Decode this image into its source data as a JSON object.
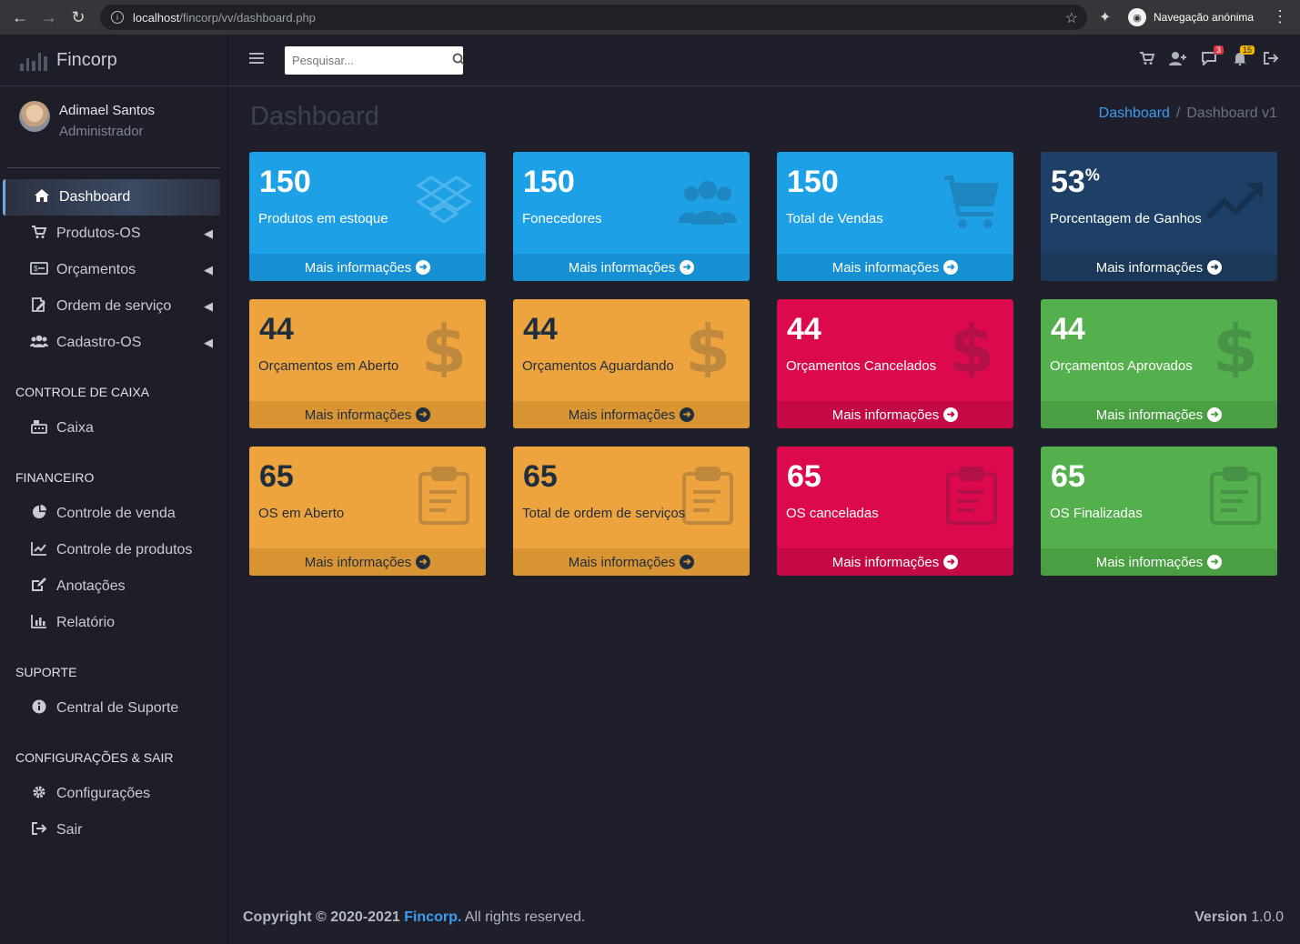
{
  "browser": {
    "url_host": "localhost",
    "url_path": "/fincorp/vv/dashboard.php",
    "incognito_label": "Navegação anónima"
  },
  "brand": {
    "name": "Fincorp"
  },
  "user": {
    "name": "Adimael Santos",
    "role": "Administrador"
  },
  "sidebar": {
    "main": [
      {
        "label": "Dashboard",
        "icon": "home-icon",
        "active": true
      },
      {
        "label": "Produtos-OS",
        "icon": "cart-icon"
      },
      {
        "label": "Orçamentos",
        "icon": "money-icon"
      },
      {
        "label": "Ordem de serviço",
        "icon": "edit-doc-icon"
      },
      {
        "label": "Cadastro-OS",
        "icon": "users-icon"
      }
    ],
    "sections": [
      {
        "title": "CONTROLE DE CAIXA",
        "items": [
          {
            "label": "Caixa",
            "icon": "cash-register-icon"
          }
        ]
      },
      {
        "title": "FINANCEIRO",
        "items": [
          {
            "label": "Controle de venda",
            "icon": "pie-chart-icon"
          },
          {
            "label": "Controle de produtos",
            "icon": "line-chart-icon"
          },
          {
            "label": "Anotações",
            "icon": "edit-icon"
          },
          {
            "label": "Relatório",
            "icon": "bar-chart-icon"
          }
        ]
      },
      {
        "title": "SUPORTE",
        "items": [
          {
            "label": "Central de Suporte",
            "icon": "info-icon"
          }
        ]
      },
      {
        "title": "CONFIGURAÇÕES & SAIR",
        "items": [
          {
            "label": "Configurações",
            "icon": "gear-icon"
          },
          {
            "label": "Sair",
            "icon": "sign-out-icon"
          }
        ]
      }
    ]
  },
  "header": {
    "search_placeholder": "Pesquisar...",
    "messages_badge": "3",
    "notifications_badge": "15"
  },
  "page": {
    "title": "Dashboard",
    "breadcrumb": {
      "link": "Dashboard",
      "current": "Dashboard v1"
    }
  },
  "cards": [
    {
      "value": "150",
      "label": "Produtos em estoque",
      "icon": "dropbox-icon",
      "color": "blue"
    },
    {
      "value": "150",
      "label": "Fonecedores",
      "icon": "users-icon",
      "color": "blue"
    },
    {
      "value": "150",
      "label": "Total de Vendas",
      "icon": "cart-icon",
      "color": "blue"
    },
    {
      "value": "53",
      "suffix": "%",
      "label": "Porcentagem de Ganhos",
      "icon": "trend-up-icon",
      "color": "navy"
    },
    {
      "value": "44",
      "label": "Orçamentos em Aberto",
      "icon": "dollar-icon",
      "color": "orange"
    },
    {
      "value": "44",
      "label": "Orçamentos Aguardando",
      "icon": "dollar-icon",
      "color": "orange"
    },
    {
      "value": "44",
      "label": "Orçamentos Cancelados",
      "icon": "dollar-icon",
      "color": "red"
    },
    {
      "value": "44",
      "label": "Orçamentos Aprovados",
      "icon": "dollar-icon",
      "color": "green"
    },
    {
      "value": "65",
      "label": "OS em Aberto",
      "icon": "clipboard-icon",
      "color": "orange"
    },
    {
      "value": "65",
      "label": "Total de ordem de serviços",
      "icon": "clipboard-icon",
      "color": "orange"
    },
    {
      "value": "65",
      "label": "OS canceladas",
      "icon": "clipboard-icon",
      "color": "red"
    },
    {
      "value": "65",
      "label": "OS Finalizadas",
      "icon": "clipboard-icon",
      "color": "green"
    }
  ],
  "card_footer": "Mais informações",
  "footer": {
    "copyright": "Copyright © 2020-2021",
    "company": "Fincorp.",
    "rights": "All rights reserved.",
    "version_label": "Version",
    "version": "1.0.0"
  }
}
